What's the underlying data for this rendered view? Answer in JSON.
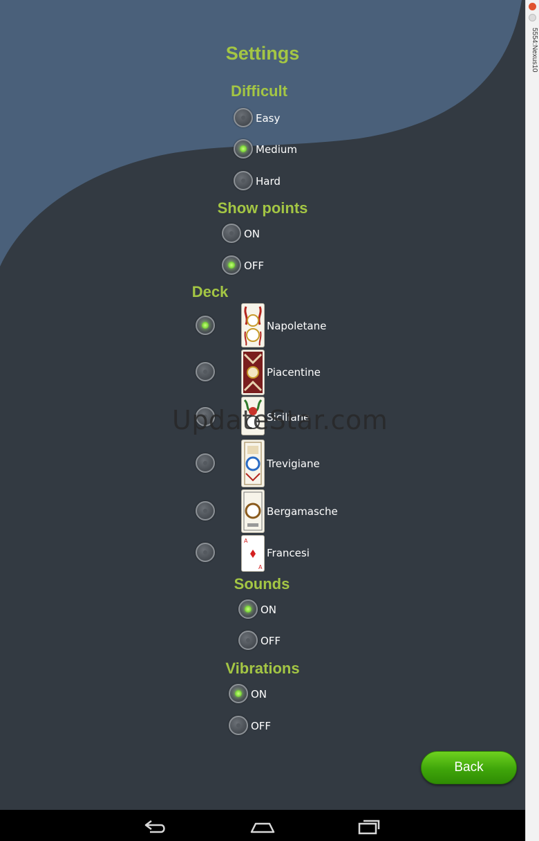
{
  "window": {
    "title": "5554:Nexus10"
  },
  "title": "Settings",
  "difficult": {
    "title": "Difficult",
    "options": [
      {
        "label": "Easy",
        "selected": false
      },
      {
        "label": "Medium",
        "selected": true
      },
      {
        "label": "Hard",
        "selected": false
      }
    ]
  },
  "show_points": {
    "title": "Show points",
    "options": [
      {
        "label": "ON",
        "selected": false
      },
      {
        "label": "OFF",
        "selected": true
      }
    ]
  },
  "deck": {
    "title": "Deck",
    "options": [
      {
        "label": "Napoletane",
        "selected": true
      },
      {
        "label": "Piacentine",
        "selected": false
      },
      {
        "label": "Siciliane",
        "selected": false
      },
      {
        "label": "Trevigiane",
        "selected": false
      },
      {
        "label": "Bergamasche",
        "selected": false
      },
      {
        "label": "Francesi",
        "selected": false
      }
    ]
  },
  "sounds": {
    "title": "Sounds",
    "options": [
      {
        "label": "ON",
        "selected": true
      },
      {
        "label": "OFF",
        "selected": false
      }
    ]
  },
  "vibrations": {
    "title": "Vibrations",
    "options": [
      {
        "label": "ON",
        "selected": true
      },
      {
        "label": "OFF",
        "selected": false
      }
    ]
  },
  "back_label": "Back",
  "watermark": "UpdateStar.com",
  "colors": {
    "accent": "#a4c644",
    "background": "#333a42",
    "wave": "#4a607a",
    "button": "#3fa50a"
  },
  "nav_icons": [
    "back-icon",
    "home-icon",
    "recent-apps-icon"
  ]
}
